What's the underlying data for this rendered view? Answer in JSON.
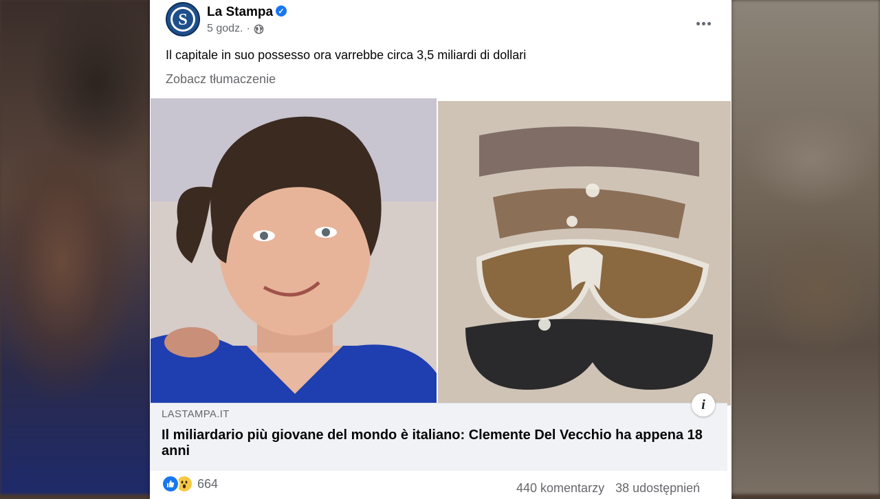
{
  "post": {
    "page_name": "La Stampa",
    "time": "5 godz.",
    "separator": "·",
    "text": "Il capitale in suo possesso ora varrebbe circa 3,5 miliardi di dollari",
    "see_translation": "Zobacz tłumaczenie"
  },
  "link_preview": {
    "domain": "LASTAMPA.IT",
    "title": "Il miliardario più giovane del mondo è italiano: Clemente Del Vecchio ha appena 18 anni",
    "info_glyph": "i"
  },
  "engagement": {
    "reaction_count": "664",
    "comments": "440 komentarzy",
    "shares": "38 udostępnień"
  },
  "icons": {
    "verified": "verified-badge-icon",
    "audience": "globe-icon",
    "more": "more-options-icon",
    "reactions": [
      "like-reaction-icon",
      "wow-reaction-icon"
    ]
  },
  "colors": {
    "accent": "#1877f2",
    "text_primary": "#050505",
    "text_secondary": "#65676b",
    "link_box": "#f0f2f5"
  }
}
